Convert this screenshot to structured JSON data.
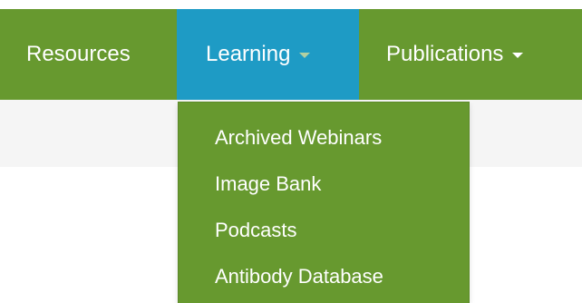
{
  "navbar": {
    "items": [
      {
        "label": "Resources",
        "has_caret": false
      },
      {
        "label": "Learning",
        "has_caret": true,
        "active": true
      },
      {
        "label": "Publications",
        "has_caret": true
      }
    ]
  },
  "dropdown": {
    "items": [
      {
        "label": "Archived Webinars"
      },
      {
        "label": "Image Bank"
      },
      {
        "label": "Podcasts"
      },
      {
        "label": "Antibody Database"
      }
    ]
  },
  "colors": {
    "nav_background": "#67992f",
    "active_tab": "#1e9bc5",
    "subbar": "#f5f5f5",
    "text": "#ffffff"
  },
  "icons": {
    "caret": "chevron-down-icon"
  }
}
